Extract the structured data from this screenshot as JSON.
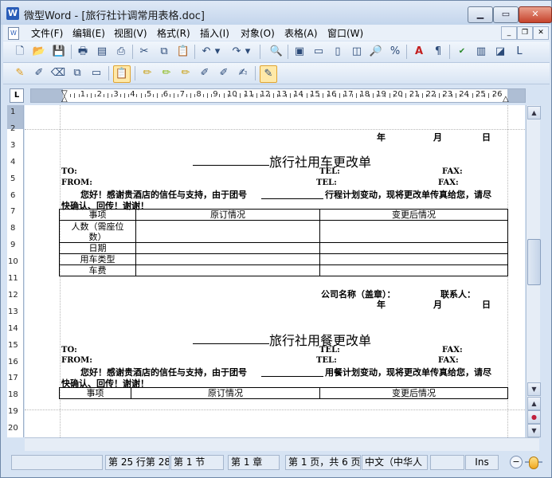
{
  "window": {
    "title": "微型Word - [旅行社计调常用表格.doc]",
    "app_icon": "W",
    "controls": [
      "minimize-icon",
      "maximize-icon",
      "close-icon"
    ]
  },
  "menu": {
    "items": [
      "文件(F)",
      "编辑(E)",
      "视图(V)",
      "格式(R)",
      "插入(I)",
      "对象(O)",
      "表格(A)",
      "窗口(W)"
    ]
  },
  "ruler": {
    "corner": "L",
    "numbers": [
      "1",
      "2",
      "3",
      "4",
      "5",
      "6",
      "7",
      "8",
      "9",
      "10",
      "11",
      "12",
      "13",
      "14",
      "15",
      "16",
      "17",
      "18",
      "19",
      "20",
      "21",
      "22",
      "23",
      "24",
      "25",
      "26"
    ],
    "vertical_numbers": [
      "1",
      "2",
      "3",
      "4",
      "5",
      "6",
      "7",
      "8",
      "9",
      "10",
      "11",
      "12",
      "13",
      "14",
      "15",
      "16",
      "17",
      "18",
      "19",
      "20"
    ]
  },
  "document": {
    "date_year": "年",
    "date_month": "月",
    "date_day": "日",
    "form1": {
      "title": "旅行社用车更改单",
      "to": "TO:",
      "tel1": "TEL:",
      "fax1": "FAX:",
      "from": "FROM:",
      "tel2": "TEL:",
      "fax2": "FAX:",
      "body_a": "您好！感谢贵酒店的信任与支持，由于团号",
      "body_b": "行程计划变动，现将更改单传真给您，请尽",
      "body_c": "快确认、回传！谢谢！",
      "headers": [
        "事项",
        "原订情况",
        "变更后情况"
      ],
      "rows": [
        "人数（需座位数）",
        "日期",
        "用车类型",
        "车费"
      ],
      "company": "公司名称（盖章）：",
      "contact": "联系人：",
      "year": "年",
      "month": "月",
      "day": "日"
    },
    "form2": {
      "title": "旅行社用餐更改单",
      "to": "TO:",
      "tel1": "TEL:",
      "fax1": "FAX:",
      "from": "FROM:",
      "tel2": "TEL:",
      "fax2": "FAX:",
      "body_a": "您好！感谢贵酒店的信任与支持，由于团号",
      "body_b": "用餐计划变动，现将更改单传真给您，请尽",
      "body_c": "快确认、回传！谢谢！",
      "headers": [
        "事项",
        "原订情况",
        "变更后情况"
      ]
    }
  },
  "status": {
    "position": "第 25 行第 28",
    "section": "第 1 节",
    "chapter": "第 1 章",
    "page": "第 1 页，共 6 页",
    "language": "中文（中华人",
    "mode": "Ins"
  }
}
